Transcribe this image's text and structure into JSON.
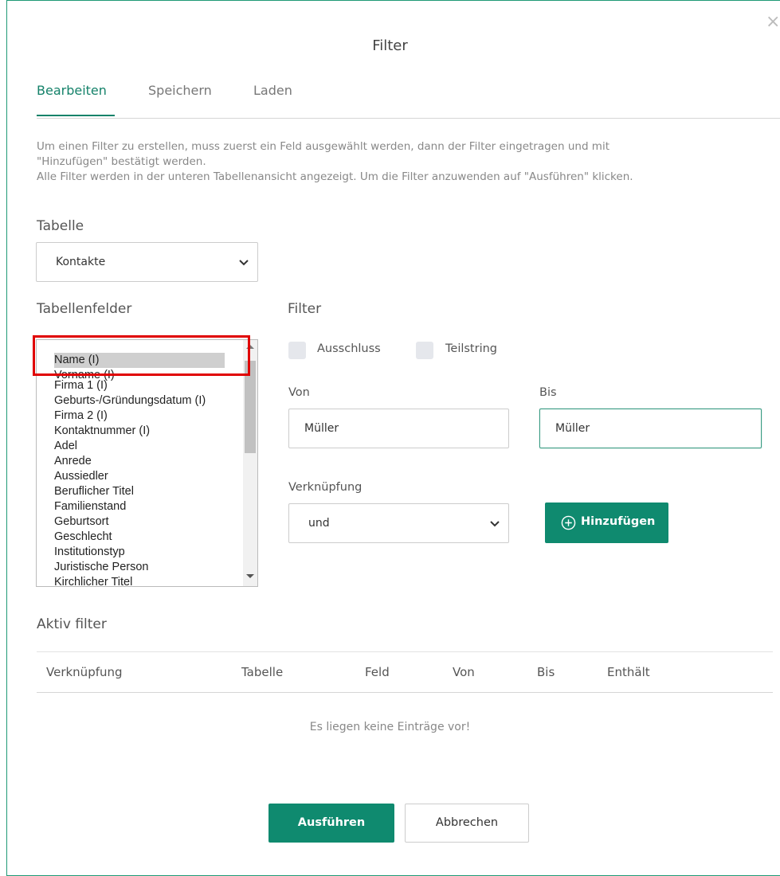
{
  "dialog": {
    "title": "Filter",
    "close_label": "×"
  },
  "tabs": [
    {
      "label": "Bearbeiten",
      "active": true
    },
    {
      "label": "Speichern",
      "active": false
    },
    {
      "label": "Laden",
      "active": false
    }
  ],
  "info": {
    "line1": "Um einen Filter zu erstellen, muss zuerst ein Feld ausgewählt werden, dann der Filter eingetragen und mit",
    "line2": "\"Hinzufügen\" bestätigt werden.",
    "line3": "Alle Filter werden in der unteren Tabellenansicht angezeigt. Um die Filter anzuwenden auf \"Ausführen\" klicken."
  },
  "tabelle": {
    "label": "Tabelle",
    "selected": "Kontakte"
  },
  "tabellenfelder": {
    "label": "Tabellenfelder",
    "items": [
      "Name (I)",
      "Vorname (I)",
      "Firma 1 (I)",
      "Geburts-/Gründungsdatum (I)",
      "Firma 2 (I)",
      "Kontaktnummer (I)",
      "Adel",
      "Anrede",
      "Aussiedler",
      "Beruflicher Titel",
      "Familienstand",
      "Geburtsort",
      "Geschlecht",
      "Institutionstyp",
      "Juristische Person",
      "Kirchlicher Titel"
    ],
    "selected_index": 0
  },
  "filter": {
    "label": "Filter",
    "ausschluss_label": "Ausschluss",
    "teilstring_label": "Teilstring",
    "von_label": "Von",
    "von_value": "Müller",
    "bis_label": "Bis",
    "bis_value": "Müller",
    "verknuepfung_label": "Verknüpfung",
    "verknuepfung_value": "und",
    "add_button": "Hinzufügen"
  },
  "aktiv": {
    "label": "Aktiv filter",
    "columns": [
      "Verknüpfung",
      "Tabelle",
      "Feld",
      "Von",
      "Bis",
      "Enthält"
    ],
    "empty_text": "Es liegen keine Einträge vor!"
  },
  "footer": {
    "run_button": "Ausführen",
    "cancel_button": "Abbrechen"
  },
  "colors": {
    "primary": "#0f8a6f",
    "border_accent": "#1f9a76",
    "highlight": "#e00000"
  }
}
